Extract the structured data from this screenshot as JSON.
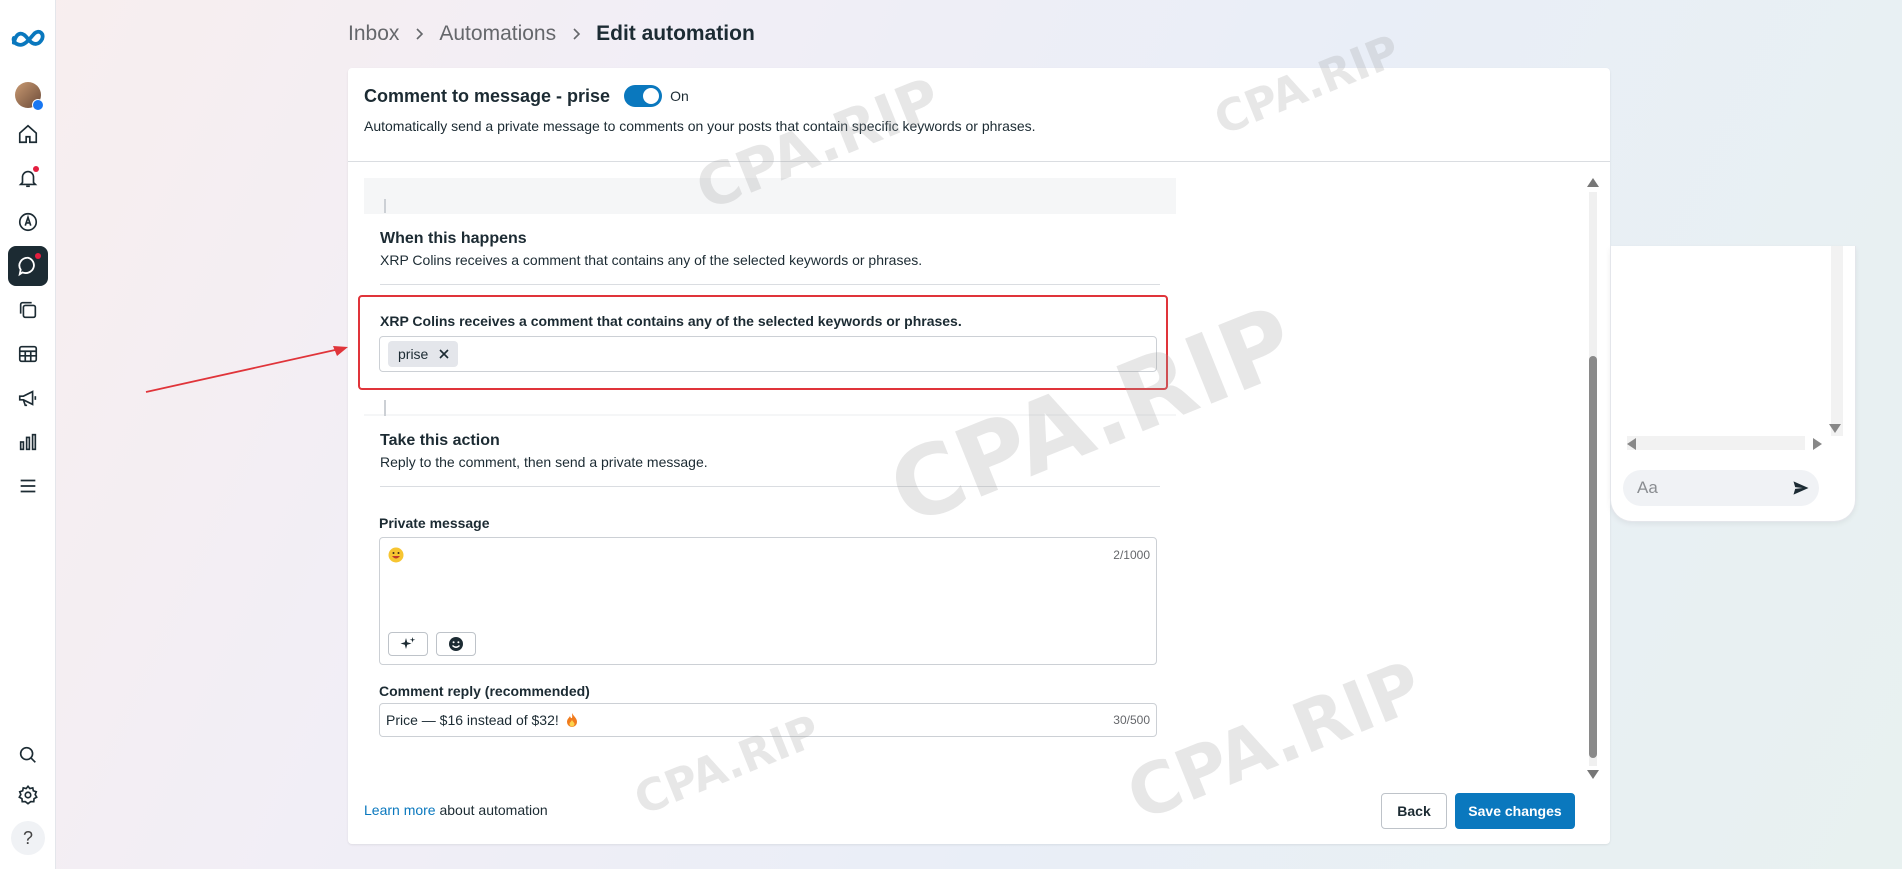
{
  "nav": {
    "items": [
      {
        "name": "meta-logo"
      },
      {
        "name": "profile-avatar"
      },
      {
        "name": "home"
      },
      {
        "name": "notifications"
      },
      {
        "name": "ads-manager"
      },
      {
        "name": "inbox"
      },
      {
        "name": "content"
      },
      {
        "name": "planner"
      },
      {
        "name": "ads"
      },
      {
        "name": "insights"
      },
      {
        "name": "all-tools"
      },
      {
        "name": "search"
      },
      {
        "name": "settings"
      },
      {
        "name": "help"
      }
    ],
    "help_glyph": "?"
  },
  "breadcrumb": {
    "items": [
      "Inbox",
      "Automations"
    ],
    "current": "Edit automation"
  },
  "automation": {
    "title": "Comment to message - prise",
    "toggle_state": "On",
    "toggle_on": true,
    "description": "Automatically send a private message to comments on your posts that contain specific keywords or phrases."
  },
  "trigger": {
    "title": "When this happens",
    "subtitle": "XRP Colins receives a comment that contains any of the selected keywords or phrases.",
    "keywords_label": "XRP Colins receives a comment that contains any of the selected keywords or phrases.",
    "keywords": [
      "prise"
    ]
  },
  "action": {
    "title": "Take this action",
    "subtitle": "Reply to the comment, then send a private message.",
    "private_message_label": "Private message",
    "private_message_counter": "2/1000",
    "comment_reply_label": "Comment reply (recommended)",
    "comment_reply_value": "Price — $16 instead of $32!",
    "comment_reply_counter": "30/500"
  },
  "preview": {
    "input_placeholder": "Aa"
  },
  "footer": {
    "learn_more_link": "Learn more",
    "learn_more_text": " about automation",
    "back_label": "Back",
    "save_label": "Save changes"
  },
  "watermark": "CPA.RIP",
  "colors": {
    "accent": "#0a78be",
    "highlight": "#e0343a",
    "text": "#1c2b33"
  }
}
